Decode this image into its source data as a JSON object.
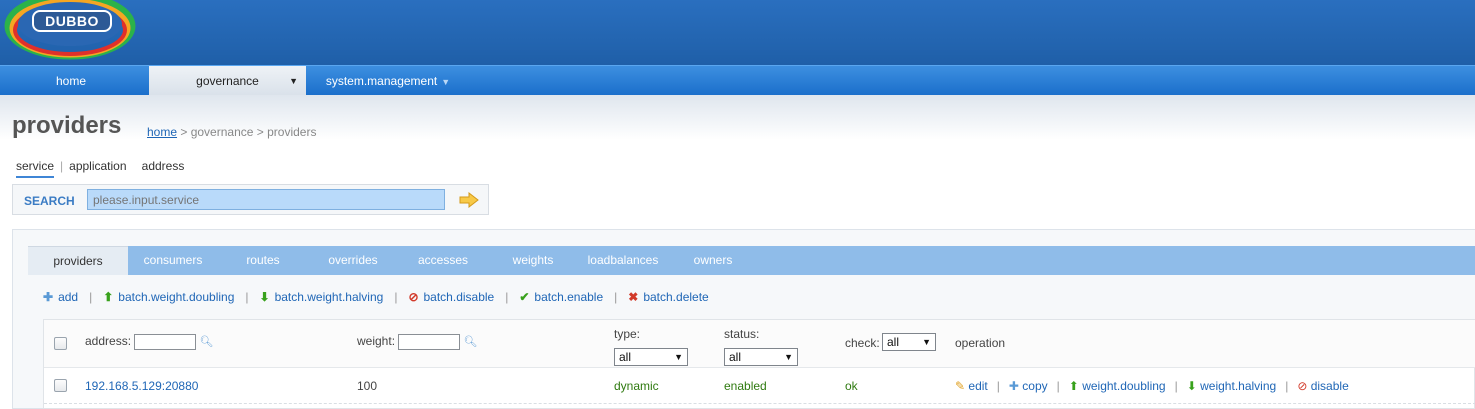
{
  "app": {
    "logo_text": "DUBBO"
  },
  "nav": {
    "home": "home",
    "governance": "governance",
    "system_management": "system.management"
  },
  "page": {
    "title": "providers",
    "breadcrumb": {
      "home": "home",
      "rest": " > governance > providers"
    }
  },
  "subtabs": [
    "service",
    "application",
    "address"
  ],
  "search": {
    "label": "SEARCH",
    "placeholder": "please.input.service"
  },
  "tabs": [
    "providers",
    "consumers",
    "routes",
    "overrides",
    "accesses",
    "weights",
    "loadbalances",
    "owners"
  ],
  "toolbar": {
    "add": "add",
    "batch_weight_doubling": "batch.weight.doubling",
    "batch_weight_halving": "batch.weight.halving",
    "batch_disable": "batch.disable",
    "batch_enable": "batch.enable",
    "batch_delete": "batch.delete"
  },
  "table": {
    "headers": {
      "address": "address:",
      "weight": "weight:",
      "type": "type:",
      "status": "status:",
      "check": "check:",
      "operation": "operation"
    },
    "filters": {
      "type": "all",
      "status": "all",
      "check": "all"
    },
    "rows": [
      {
        "address": "192.168.5.129:20880",
        "weight": "100",
        "type": "dynamic",
        "status": "enabled",
        "check": "ok",
        "ops": {
          "edit": "edit",
          "copy": "copy",
          "weight_doubling": "weight.doubling",
          "weight_halving": "weight.halving",
          "disable": "disable"
        }
      }
    ]
  },
  "colors": {
    "header": "#1f5fa8",
    "nav": "#1b6fcb",
    "tabs": "#8fbce9",
    "link": "#1f66b6",
    "ok_green": "#2f7a10"
  }
}
